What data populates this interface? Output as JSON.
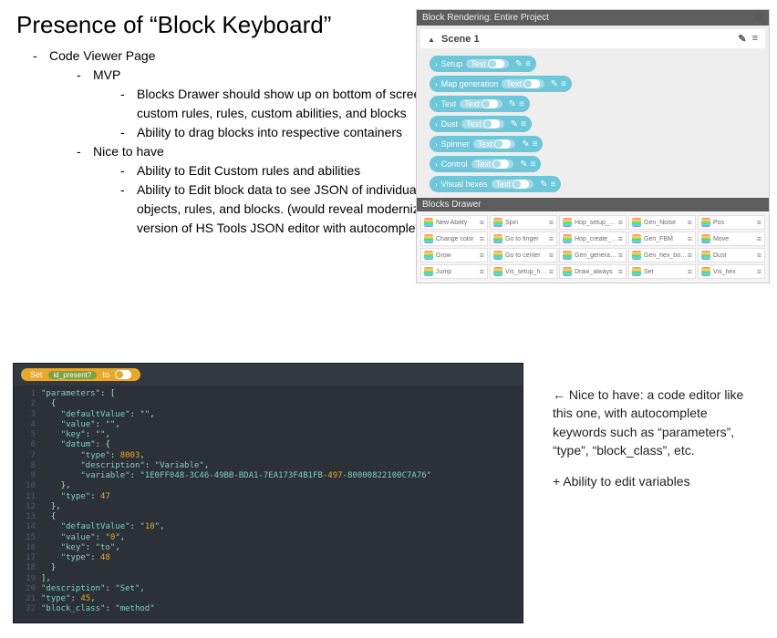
{
  "title": "Presence of “Block Keyboard”",
  "outline": {
    "l1": "Code Viewer Page",
    "l2a": "MVP",
    "mvp1": "Blocks Drawer should show up on bottom of screen with custom rules, rules, custom abilities, and blocks",
    "mvp2": "Ability to drag blocks into respective containers",
    "l2b": "Nice to have",
    "nth1": "Ability to Edit Custom rules and abilities",
    "nth2": "Ability to Edit block data to see JSON of individual objects, rules, and blocks. (would reveal modernized version of HS Tools JSON editor with autocomplete)"
  },
  "panel": {
    "header": "Block Rendering: Entire Project",
    "scene": "Scene 1",
    "text_label": "Text",
    "blocks": [
      "Setup",
      "Map generation",
      "Text",
      "Dust",
      "Spinner",
      "Control",
      "Visual hexes"
    ]
  },
  "drawer": {
    "header": "Blocks Drawer",
    "items": [
      "New Ability",
      "Spin",
      "Hop_setup_world_gener",
      "Gen_Noise",
      "Pos",
      "Change color",
      "Go to finger",
      "Hop_create_clones",
      "Gen_FBM",
      "Move",
      "Grow",
      "Go to center",
      "Gen_generate_map",
      "Gen_hex_borders",
      "Dust",
      "Jump",
      "Vis_setup_hexagons",
      "Draw_always",
      "Set",
      "Vis_hex"
    ]
  },
  "code": {
    "chip_label": "Set",
    "chip_inner": "id_present?",
    "chip_to": "to",
    "lines": [
      "\"parameters\": [",
      "  {",
      "    \"defaultValue\": \"\",",
      "    \"value\": \"\",",
      "    \"key\": \"\",",
      "    \"datum\": {",
      "        \"type\": 8003,",
      "        \"description\": \"Variable\",",
      "        \"variable\": \"1E0FF048-3C46-49BB-BDA1-7EA173F4B1FB-497-80000822100C7A76\"",
      "    },",
      "    \"type\": 47",
      "  },",
      "  {",
      "    \"defaultValue\": \"10\",",
      "    \"value\": \"0\",",
      "    \"key\": \"to\",",
      "    \"type\": 48",
      "  }",
      "],",
      "\"description\": \"Set\",",
      "\"type\": 45,",
      "\"block_class\": \"method\""
    ]
  },
  "note": {
    "p1": "← Nice to have: a code editor like this one, with autocomplete keywords such as “parameters”, “type”, “block_class”, etc.",
    "p2": "+ Ability to edit variables"
  }
}
